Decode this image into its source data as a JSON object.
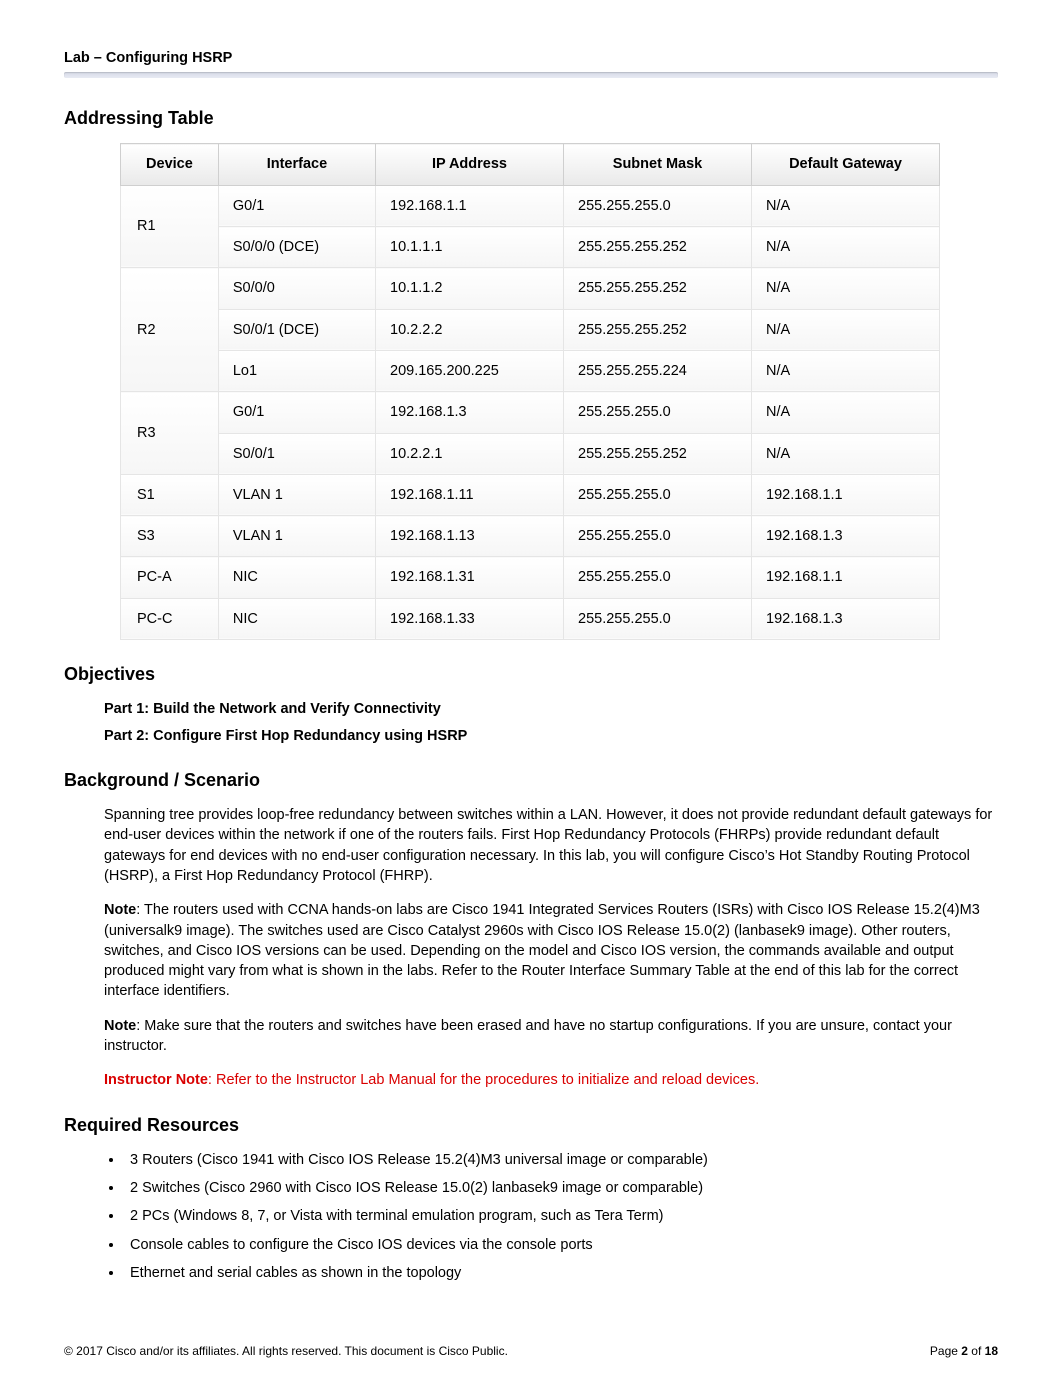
{
  "header": {
    "lab_title": "Lab – Configuring HSRP"
  },
  "sections": {
    "addressing": "Addressing Table",
    "objectives": "Objectives",
    "background": "Background / Scenario",
    "resources": "Required Resources"
  },
  "table": {
    "headers": {
      "device": "Device",
      "interface": "Interface",
      "ip": "IP Address",
      "mask": "Subnet Mask",
      "gateway": "Default Gateway"
    },
    "groups": [
      {
        "device": "R1",
        "rows": [
          {
            "interface": "G0/1",
            "ip": "192.168.1.1",
            "mask": "255.255.255.0",
            "gw": "N/A"
          },
          {
            "interface": "S0/0/0 (DCE)",
            "ip": "10.1.1.1",
            "mask": "255.255.255.252",
            "gw": "N/A"
          }
        ]
      },
      {
        "device": "R2",
        "rows": [
          {
            "interface": "S0/0/0",
            "ip": "10.1.1.2",
            "mask": "255.255.255.252",
            "gw": "N/A"
          },
          {
            "interface": "S0/0/1 (DCE)",
            "ip": "10.2.2.2",
            "mask": "255.255.255.252",
            "gw": "N/A"
          },
          {
            "interface": "Lo1",
            "ip": "209.165.200.225",
            "mask": "255.255.255.224",
            "gw": "N/A"
          }
        ]
      },
      {
        "device": "R3",
        "rows": [
          {
            "interface": "G0/1",
            "ip": "192.168.1.3",
            "mask": "255.255.255.0",
            "gw": "N/A"
          },
          {
            "interface": "S0/0/1",
            "ip": "10.2.2.1",
            "mask": "255.255.255.252",
            "gw": "N/A"
          }
        ]
      },
      {
        "device": "S1",
        "rows": [
          {
            "interface": "VLAN 1",
            "ip": "192.168.1.11",
            "mask": "255.255.255.0",
            "gw": "192.168.1.1"
          }
        ]
      },
      {
        "device": "S3",
        "rows": [
          {
            "interface": "VLAN 1",
            "ip": "192.168.1.13",
            "mask": "255.255.255.0",
            "gw": "192.168.1.3"
          }
        ]
      },
      {
        "device": "PC-A",
        "rows": [
          {
            "interface": "NIC",
            "ip": "192.168.1.31",
            "mask": "255.255.255.0",
            "gw": "192.168.1.1"
          }
        ]
      },
      {
        "device": "PC-C",
        "rows": [
          {
            "interface": "NIC",
            "ip": "192.168.1.33",
            "mask": "255.255.255.0",
            "gw": "192.168.1.3"
          }
        ]
      }
    ]
  },
  "objectives": {
    "part1": "Part 1: Build the Network and Verify Connectivity",
    "part2": "Part 2: Configure First Hop Redundancy using HSRP"
  },
  "background": {
    "p1": "Spanning tree provides loop-free redundancy between switches within a LAN. However, it does not provide redundant default gateways for end-user devices within the network if one of the routers fails. First Hop Redundancy Protocols (FHRPs) provide redundant default gateways for end devices with no end-user configuration necessary. In this lab, you will configure Cisco’s Hot Standby Routing Protocol (HSRP), a First Hop Redundancy Protocol (FHRP).",
    "note1_label": "Note",
    "note1_body": ": The routers used with CCNA hands-on labs are Cisco 1941 Integrated Services Routers (ISRs) with Cisco IOS Release 15.2(4)M3 (universalk9 image). The switches used are Cisco Catalyst 2960s with Cisco IOS Release 15.0(2) (lanbasek9 image). Other routers, switches, and Cisco IOS versions can be used. Depending on the model and Cisco IOS version, the commands available and output produced might vary from what is shown in the labs. Refer to the Router Interface Summary Table at the end of this lab for the correct interface identifiers.",
    "note2_label": "Note",
    "note2_body": ": Make sure that the routers and switches have been erased and have no startup configurations. If you are unsure, contact your instructor.",
    "inst_label": "Instructor Note",
    "inst_body": ": Refer to the Instructor Lab Manual for the procedures to initialize and reload devices."
  },
  "resources": {
    "items": [
      "3 Routers (Cisco 1941 with Cisco IOS Release 15.2(4)M3 universal image or comparable)",
      "2 Switches (Cisco 2960 with Cisco IOS Release 15.0(2) lanbasek9 image or comparable)",
      "2 PCs (Windows 8, 7, or Vista with terminal emulation program, such as Tera Term)",
      "Console cables to configure the Cisco IOS devices via the console ports",
      "Ethernet and serial cables as shown in the topology"
    ]
  },
  "footer": {
    "copyright": "© 2017 Cisco and/or its affiliates. All rights reserved. This document is Cisco Public.",
    "page_label": "Page ",
    "page_current": "2",
    "page_of": " of ",
    "page_total": "18"
  }
}
